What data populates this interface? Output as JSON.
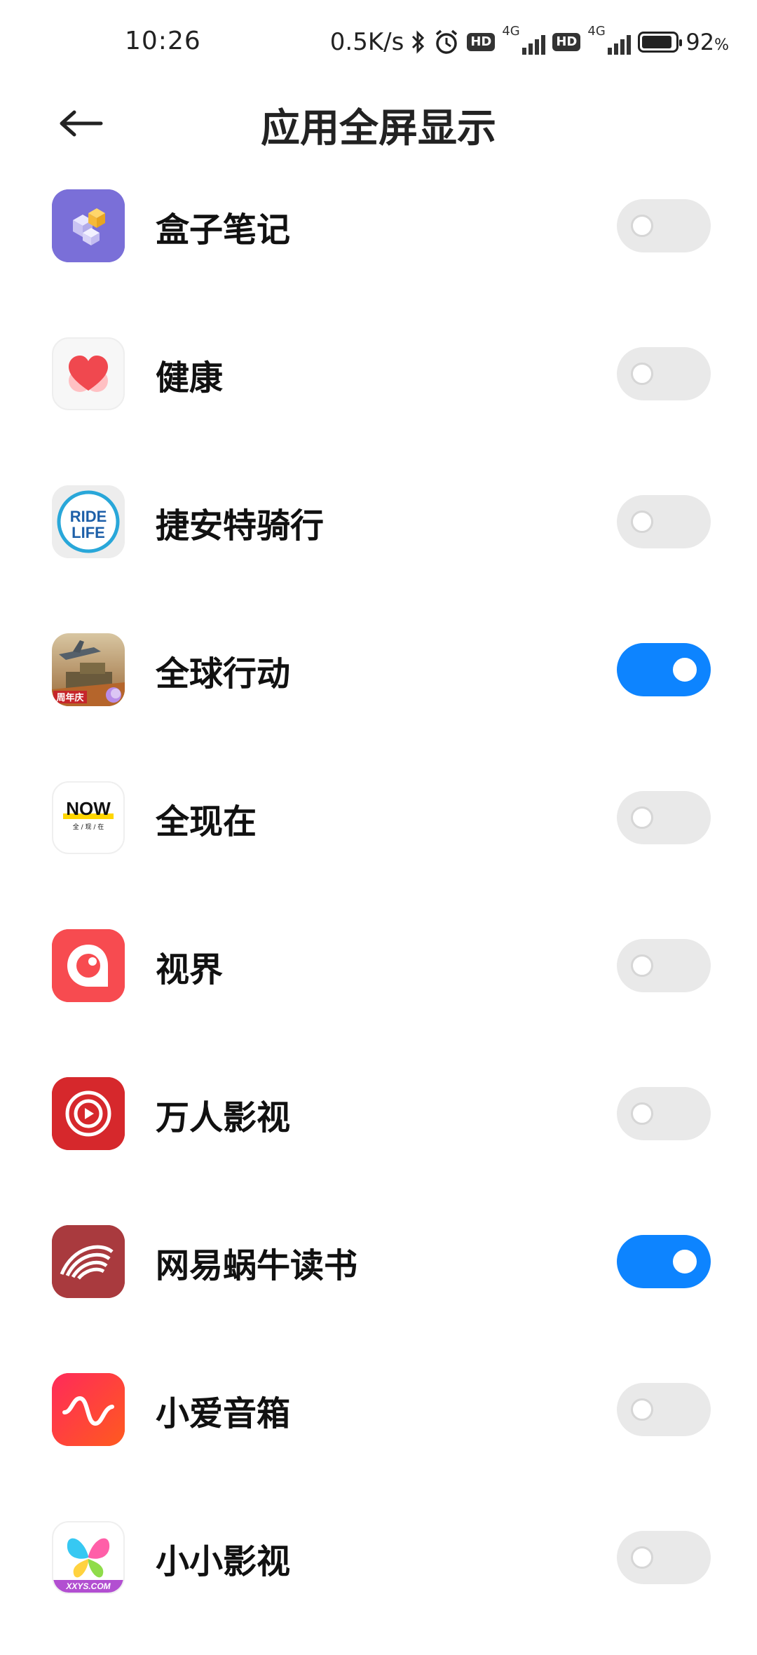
{
  "status_bar": {
    "time": "10:26",
    "net_speed": "0.5K/s",
    "sim1_tag": "4G",
    "sim2_tag": "4G",
    "hd_label": "HD",
    "battery_percent": "92",
    "battery_unit": "%",
    "battery_level": 0.92
  },
  "header": {
    "title": "应用全屏显示"
  },
  "apps": [
    {
      "name": "盒子笔记",
      "enabled": false,
      "icon": "box-notes-icon"
    },
    {
      "name": "健康",
      "enabled": false,
      "icon": "health-heart-icon"
    },
    {
      "name": "捷安特骑行",
      "enabled": false,
      "icon": "ride-life-icon",
      "icon_text_1": "RIDE",
      "icon_text_2": "LIFE"
    },
    {
      "name": "全球行动",
      "enabled": true,
      "icon": "global-action-icon",
      "icon_text": "周年庆"
    },
    {
      "name": "全现在",
      "enabled": false,
      "icon": "now-icon",
      "icon_text": "NOW",
      "icon_sub": "全 / 现 / 在"
    },
    {
      "name": "视界",
      "enabled": false,
      "icon": "vision-eye-icon"
    },
    {
      "name": "万人影视",
      "enabled": false,
      "icon": "play-circle-icon"
    },
    {
      "name": "网易蜗牛读书",
      "enabled": true,
      "icon": "snail-read-icon"
    },
    {
      "name": "小爱音箱",
      "enabled": false,
      "icon": "wave-icon"
    },
    {
      "name": "小小影视",
      "enabled": false,
      "icon": "butterfly-icon",
      "icon_text": "XXYS.COM"
    }
  ],
  "colors": {
    "toggle_on": "#0d84ff",
    "toggle_off": "#e9e9e9"
  }
}
